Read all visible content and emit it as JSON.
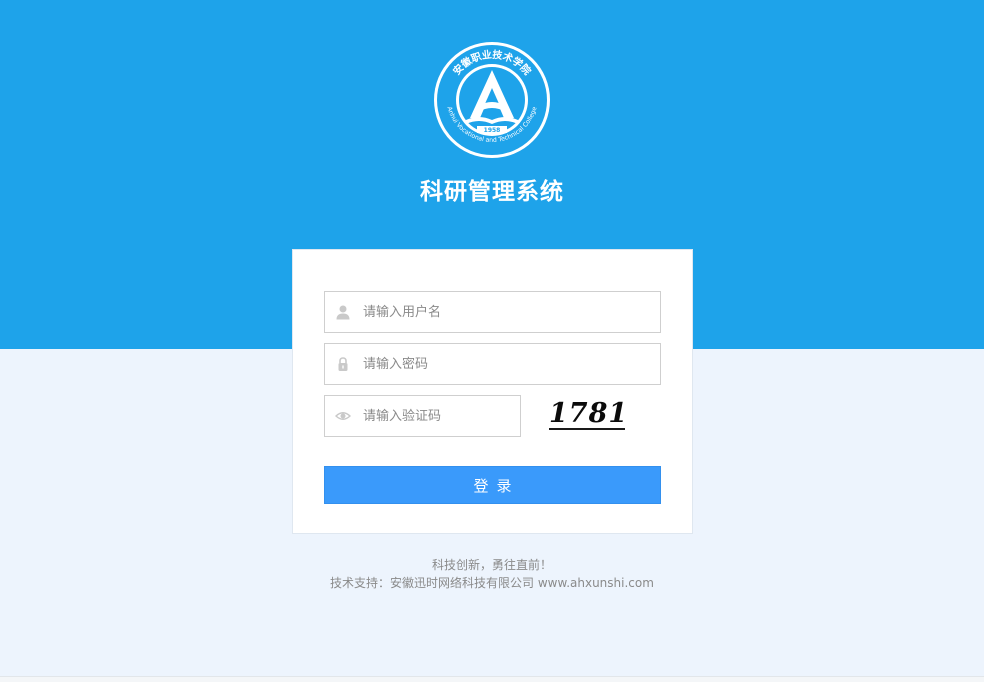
{
  "header": {
    "logo": {
      "name_cn": "安徽职业技术学院",
      "name_en": "Anhui Vocational and Technical College",
      "year": "1958"
    },
    "title": "科研管理系统"
  },
  "login_form": {
    "username": {
      "value": "",
      "placeholder": "请输入用户名",
      "icon": "user-icon"
    },
    "password": {
      "value": "",
      "placeholder": "请输入密码",
      "icon": "lock-icon"
    },
    "captcha": {
      "value": "",
      "placeholder": "请输入验证码",
      "icon": "eye-icon",
      "image_text": "1781"
    },
    "submit_label": "登录"
  },
  "footer": {
    "slogan": "科技创新，勇往直前！",
    "support": "技术支持：安徽迅时网络科技有限公司 www.ahxunshi.com"
  },
  "colors": {
    "header_band": "#1ea3ea",
    "page_background": "#edf4fd",
    "button": "#3a9afb"
  }
}
